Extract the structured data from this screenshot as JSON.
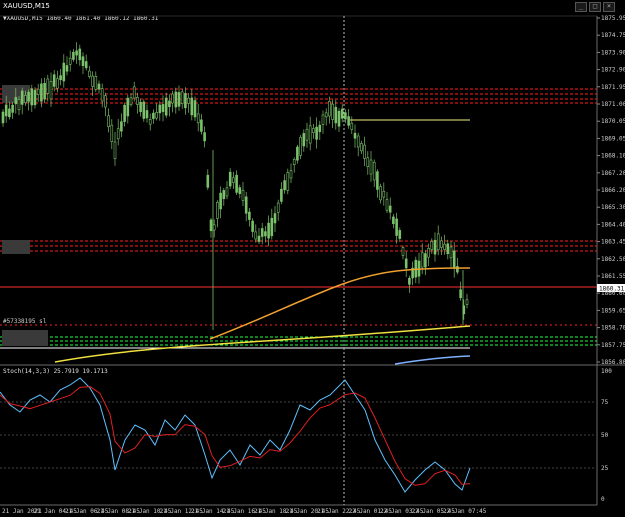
{
  "window": {
    "title": "XAUUSD,M15",
    "controls": [
      "_",
      "□",
      "×"
    ]
  },
  "chart": {
    "header": "▼XAUUSD,M15  1860.40 1861.40 1860.12 1860.31",
    "line_label": "#57338195 sl",
    "current_price": "1860.31",
    "price_axis_labels": [
      "1875.95",
      "1874.75",
      "1873.90",
      "1872.90",
      "1871.95",
      "1871.00",
      "1870.05",
      "1869.05",
      "1868.10",
      "1867.20",
      "1866.20",
      "1865.30",
      "1864.40",
      "1863.45",
      "1862.50",
      "1861.55",
      "1860.60",
      "1859.65",
      "1858.70",
      "1857.75",
      "1856.80"
    ],
    "time_labels": [
      "21 Jan 2021",
      "21 Jan 04:45",
      "21 Jan 06:45",
      "21 Jan 08:45",
      "21 Jan 10:45",
      "21 Jan 12:45",
      "21 Jan 14:45",
      "21 Jan 16:45",
      "21 Jan 18:45",
      "21 Jan 20:45",
      "21 Jan 22:45",
      "22 Jan 01:45",
      "22 Jan 03:45",
      "22 Jan 05:45",
      "22 Jan 07:45"
    ]
  },
  "oscillator": {
    "header": "Stoch(14,3,3) 25.7919 19.1713",
    "axis_labels": [
      "100",
      "75",
      "50",
      "25",
      "0"
    ]
  },
  "colors": {
    "candle_up": "#7bc16b",
    "ma_orange": "#f0a030",
    "ma_yellow": "#f0e040",
    "ma_blue": "#7fb0ff",
    "red_level": "#ff2020",
    "green_level": "#20ff40"
  },
  "icons": [
    "minimize-icon",
    "maximize-icon",
    "close-icon"
  ]
}
